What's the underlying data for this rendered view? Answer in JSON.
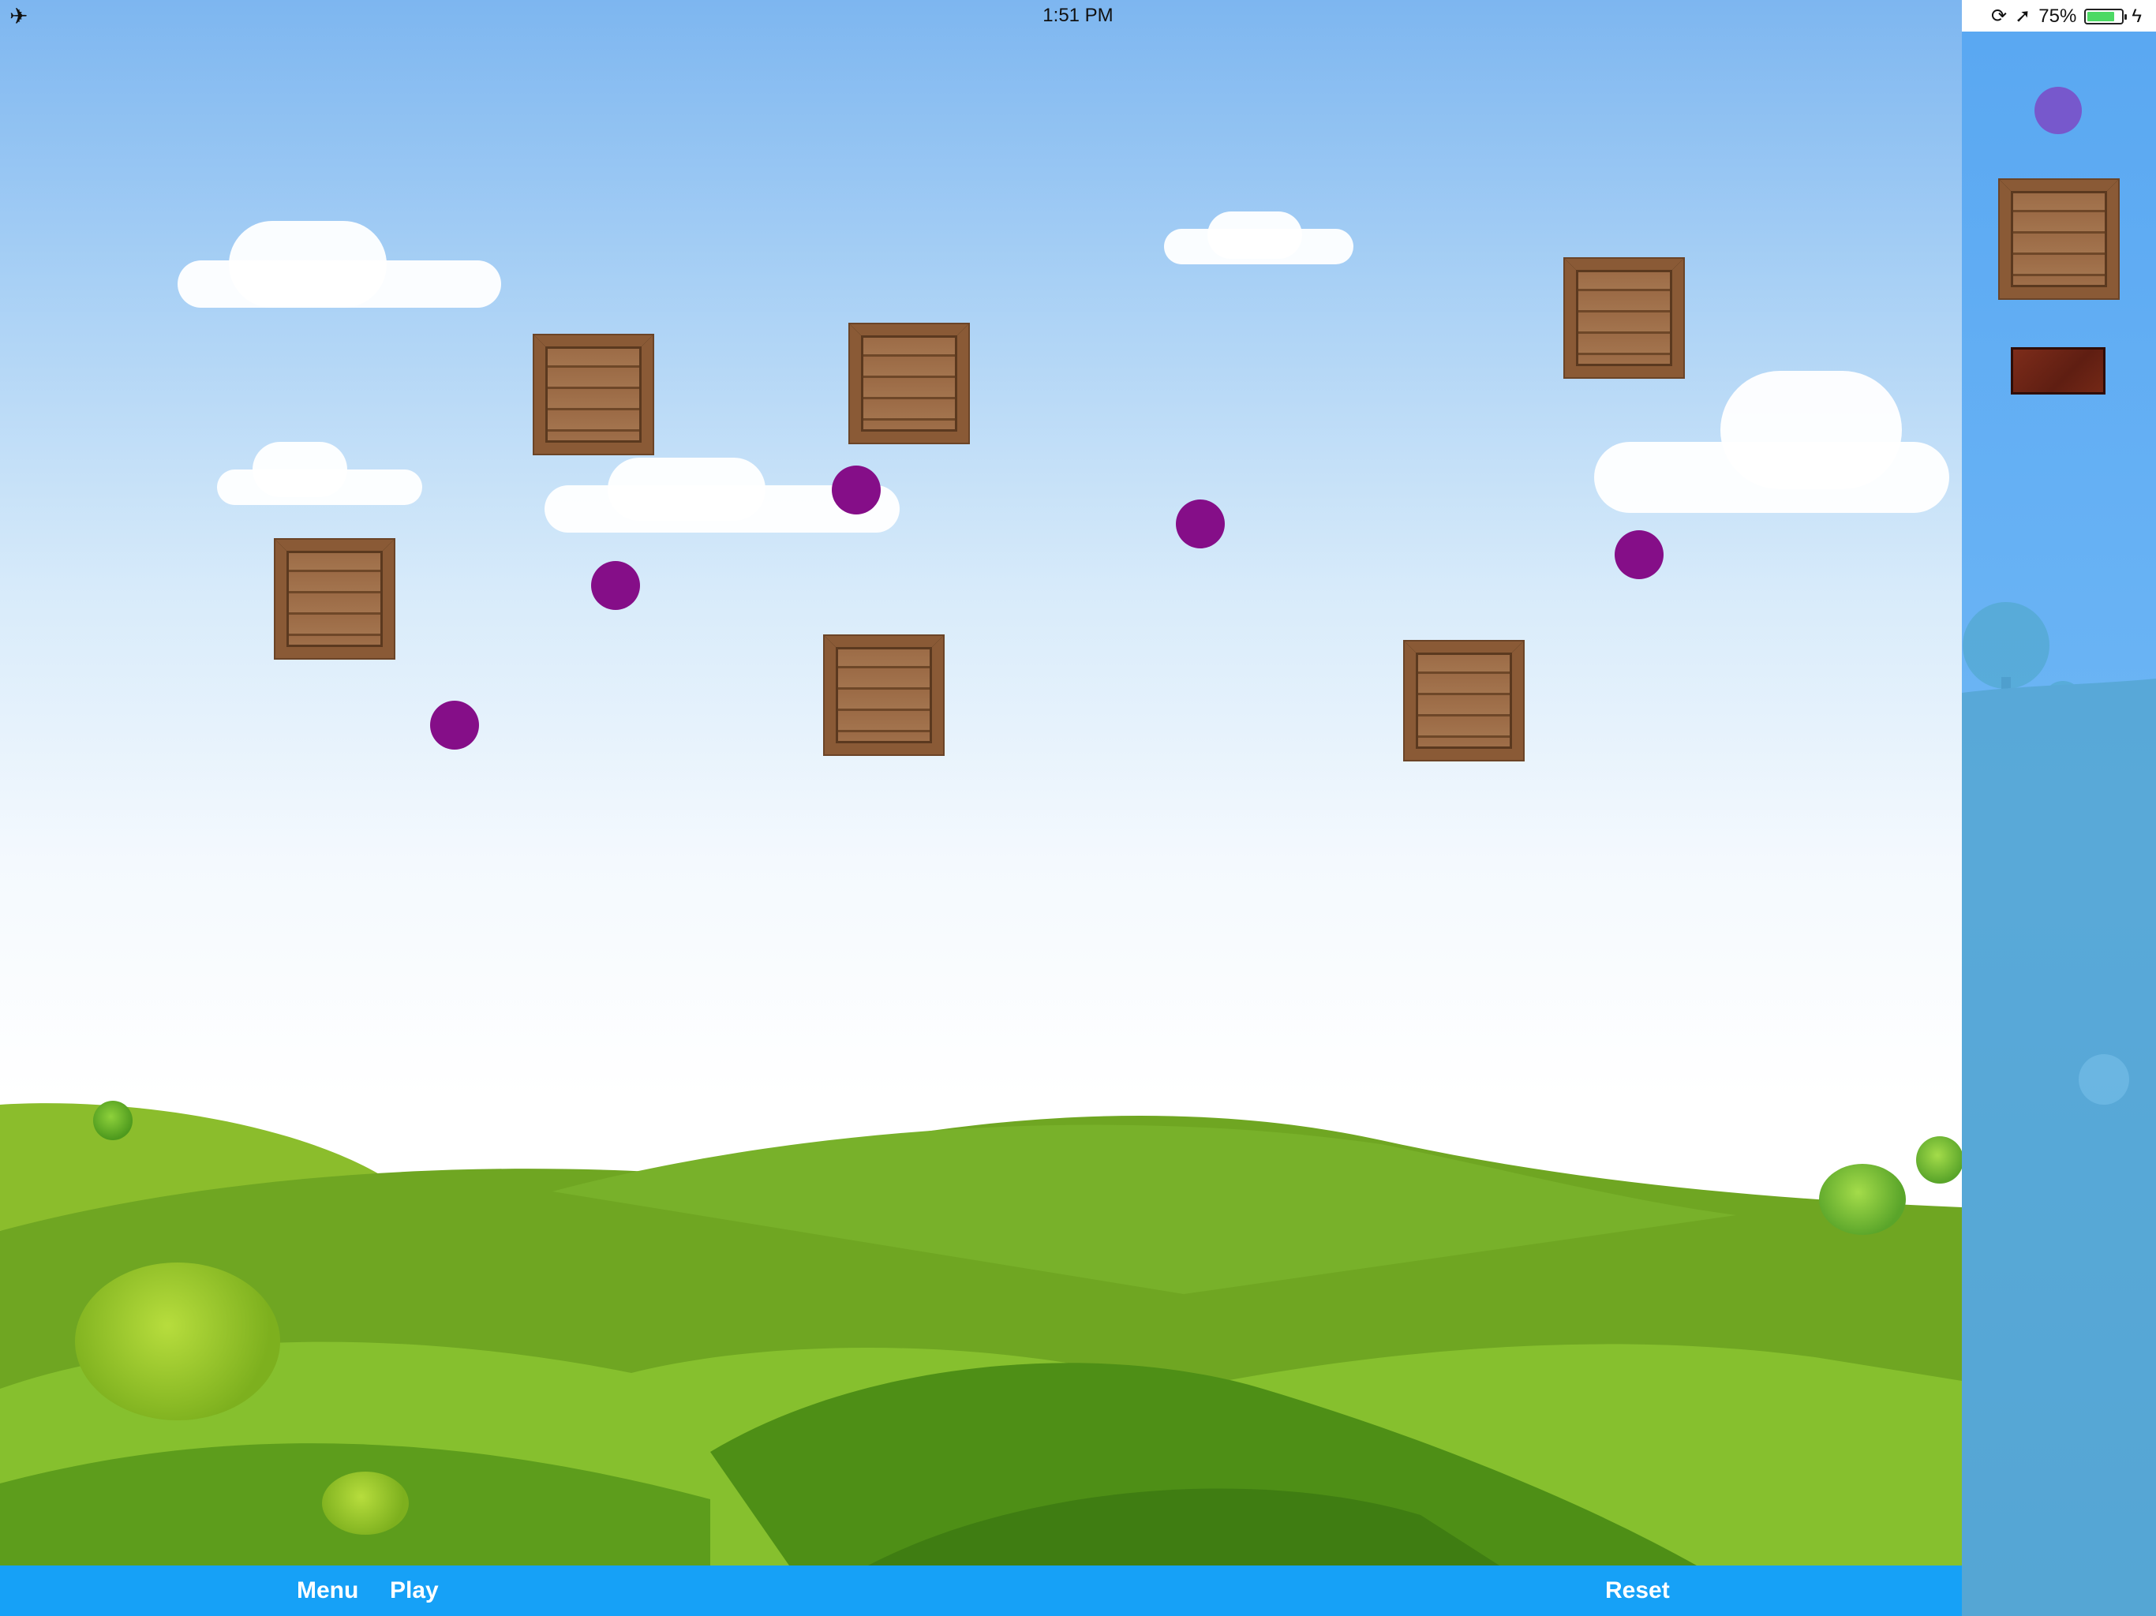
{
  "status_bar": {
    "time": "1:51 PM",
    "battery_text": "75%",
    "airplane_icon": "airplane-icon",
    "battery_level": 0.75
  },
  "toolbar": {
    "menu_label": "Menu",
    "play_label": "Play",
    "reset_label": "Reset"
  },
  "palette": {
    "tools": [
      "ball-tool",
      "crate-tool",
      "brick-tool"
    ]
  },
  "colors": {
    "ball": "#850e88",
    "toolbar": "#16a1f7",
    "sidebar": "#6db6f5"
  }
}
